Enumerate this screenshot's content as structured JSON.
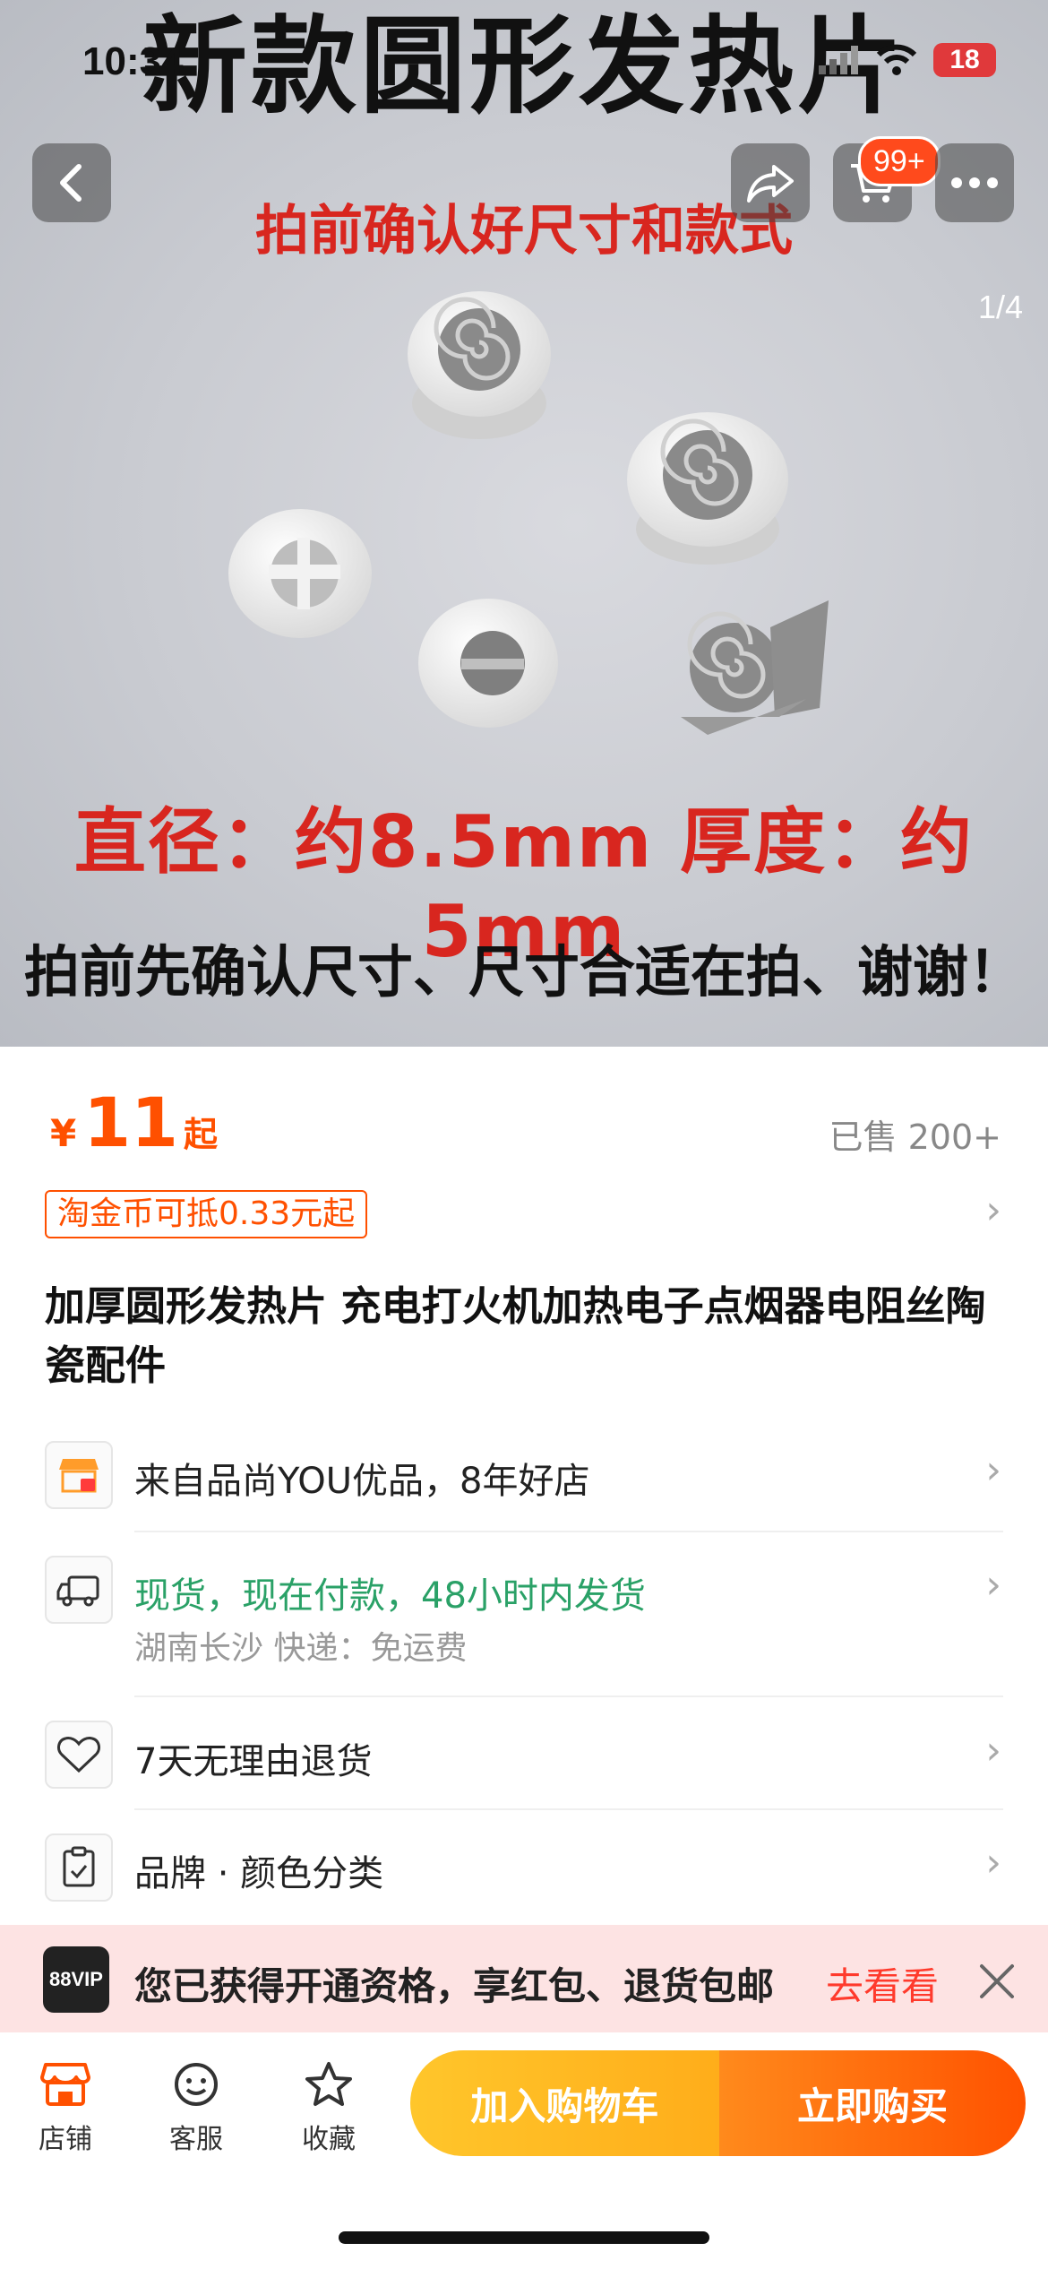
{
  "status_bar": {
    "time": "10:34",
    "battery": "18"
  },
  "hero": {
    "title": "新款圆形发热片",
    "subtitle": "拍前确认好尺寸和款式",
    "spec": "直径：约8.5mm  厚度：约5mm",
    "note": "拍前先确认尺寸、尺寸合适在拍、谢谢！",
    "cart_badge": "99+",
    "image_counter": "1/4"
  },
  "price": {
    "symbol": "¥",
    "value": "11",
    "suffix": "起",
    "sold": "已售 200+"
  },
  "coupon": "淘金币可抵0.33元起",
  "product_title": "加厚圆形发热片 充电打火机加热电子点烟器电阻丝陶瓷配件",
  "rows": {
    "shop": "来自品尚YOU优品，8年好店",
    "shipping_main": "现货，现在付款，48小时内发货",
    "shipping_sub": "湖南长沙  快递：免运费",
    "returns": "7天无理由退货",
    "sku": "品牌 · 颜色分类"
  },
  "vip": {
    "logo": "88VIP",
    "text": "您已获得开通资格，享红包、退货包邮",
    "link": "去看看"
  },
  "bottom_bar": {
    "shop": "店铺",
    "service": "客服",
    "favorite": "收藏",
    "add_cart": "加入购物车",
    "buy_now": "立即购买"
  },
  "colors": {
    "accent": "#ff5000",
    "green": "#2aa167",
    "cart_btn": "#ffb020",
    "buy_btn": "#ff5a00"
  }
}
